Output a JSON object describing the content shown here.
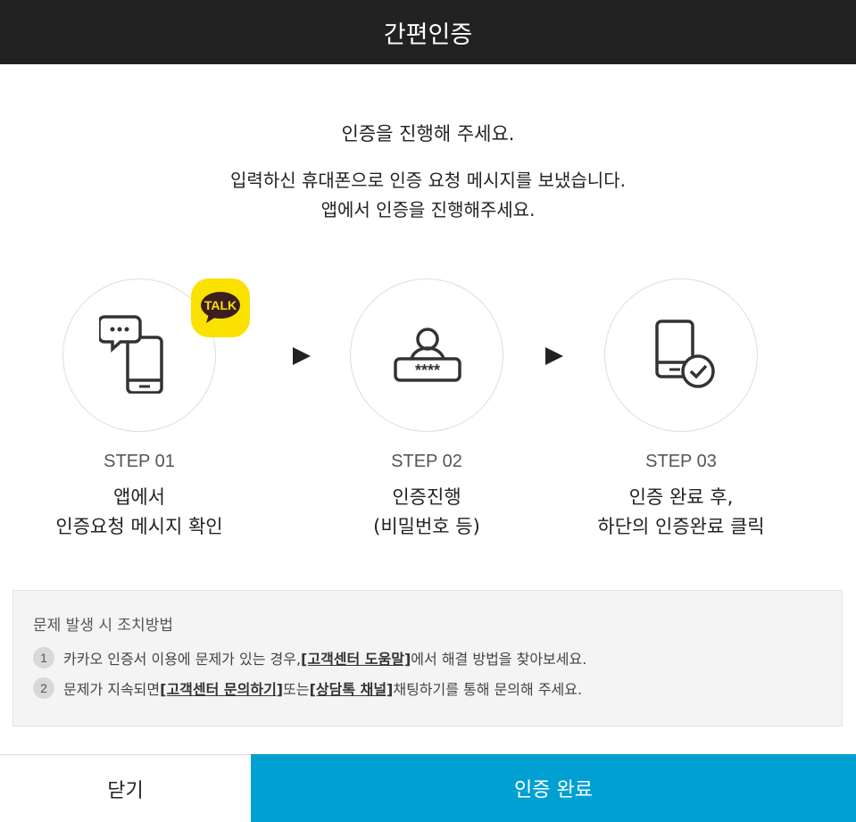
{
  "header": {
    "title": "간편인증"
  },
  "intro": {
    "main_message": "인증을 진행해 주세요.",
    "sub_line1": "입력하신 휴대폰으로 인증 요청 메시지를 보냈습니다.",
    "sub_line2": "앱에서 인증을 진행해주세요."
  },
  "steps": [
    {
      "number": "STEP 01",
      "line1": "앱에서",
      "line2": "인증요청 메시지 확인",
      "icon": "phone-chat-icon"
    },
    {
      "number": "STEP 02",
      "line1": "인증진행",
      "line2": "(비밀번호 등)",
      "icon": "user-password-icon"
    },
    {
      "number": "STEP 03",
      "line1": "인증 완료 후,",
      "line2": "하단의 인증완료 클릭",
      "icon": "phone-check-icon"
    }
  ],
  "talk_badge": {
    "label": "TALK",
    "color": "#fae100"
  },
  "help": {
    "title": "문제 발생 시 조치방법",
    "items": [
      {
        "num": "1",
        "pre": "카카오 인증서 이용에 문제가 있는 경우, ",
        "link1": "[고객센터 도움말]",
        "mid": " 에서 해결 방법을 찾아보세요.",
        "link2": "",
        "post": ""
      },
      {
        "num": "2",
        "pre": "문제가 지속되면 ",
        "link1": "[고객센터 문의하기]",
        "mid": " 또는 ",
        "link2": "[상담톡 채널]",
        "post": " 채팅하기를 통해 문의해 주세요."
      }
    ]
  },
  "footer": {
    "close_label": "닫기",
    "done_label": "인증 완료"
  },
  "colors": {
    "header_bg": "#222222",
    "accent": "#00a0d2",
    "kakao_yellow": "#fae100"
  }
}
